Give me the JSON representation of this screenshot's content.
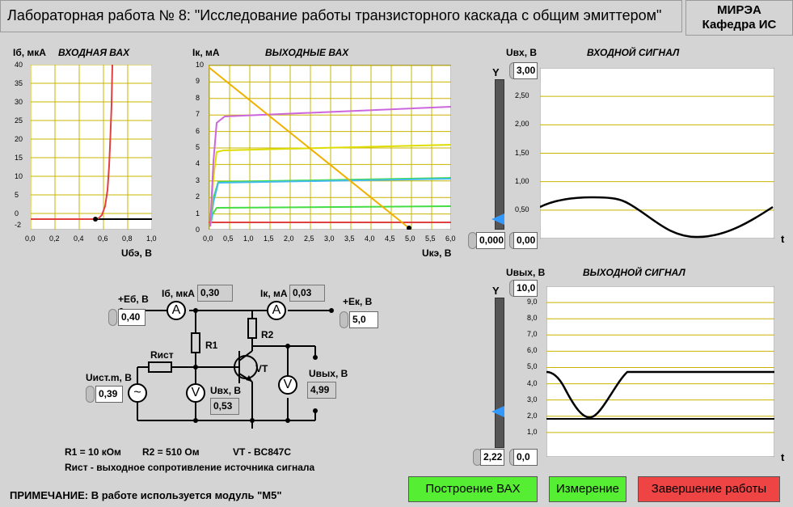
{
  "window": {
    "title": "Лабораторная работа № 8: \"Исследование работы транзисторного каскада с общим эмиттером\"",
    "org_line1": "МИРЭА",
    "org_line2": "Кафедра ИС"
  },
  "input_vax": {
    "ylabel": "Iб, мкА",
    "title": "ВХОДНАЯ ВАХ",
    "xlabel": "Uбэ, В",
    "yticks": [
      "40",
      "35",
      "30",
      "25",
      "20",
      "15",
      "10",
      "5",
      "0",
      "-2"
    ],
    "xticks": [
      "0,0",
      "0,2",
      "0,4",
      "0,6",
      "0,8",
      "1,0"
    ]
  },
  "output_vax": {
    "ylabel": "Iк, мА",
    "title": "ВЫХОДНЫЕ ВАХ",
    "xlabel": "Uкэ, В",
    "yticks": [
      "10",
      "9",
      "8",
      "7",
      "6",
      "5",
      "4",
      "3",
      "2",
      "1",
      "0"
    ],
    "xticks": [
      "0,0",
      "0,5",
      "1,0",
      "1,5",
      "2,0",
      "2,5",
      "3,0",
      "3,5",
      "4,0",
      "4,5",
      "5,0",
      "5,5",
      "6,0"
    ]
  },
  "input_signal": {
    "ylabel": "Uвх, В",
    "title": "ВХОДНОЙ СИГНАЛ",
    "yticks": [
      "2,50",
      "2,00",
      "1,50",
      "1,00",
      "0,50"
    ],
    "scale_max": "3,00",
    "scale_min": "0,00",
    "slider_label": "Y",
    "slider_value": "0,000",
    "t_label": "t"
  },
  "output_signal": {
    "ylabel": "Uвых, В",
    "title": "ВЫХОДНОЙ СИГНАЛ",
    "yticks": [
      "9,0",
      "8,0",
      "7,0",
      "6,0",
      "5,0",
      "4,0",
      "3,0",
      "2,0",
      "1,0"
    ],
    "scale_max": "10,0",
    "scale_min": "0,0",
    "slider_label": "Y",
    "slider_value": "2,22",
    "t_label": "t"
  },
  "circuit": {
    "eb_label": "+Eб, В",
    "eb_value": "0,40",
    "ib_label": "Iб, мкА",
    "ib_value": "0,30",
    "ik_label": "Iк, мА",
    "ik_value": "0,03",
    "ek_label": "+Eк, В",
    "ek_value": "5,0",
    "r1": "R1",
    "r2": "R2",
    "rist": "Rист",
    "vt": "VT",
    "uist_label": "Uист.m, В",
    "uist_value": "0,39",
    "uvx_label": "Uвх, В",
    "uvx_value": "0,53",
    "uvyx_label": "Uвых, В",
    "uvyx_value": "4,99",
    "ammeter": "A",
    "voltmeter": "V",
    "source": "~",
    "r1_value": "R1 = 10 кОм",
    "r2_value": "R2 =  510 Ом",
    "vt_value": "VT - BC847C",
    "rist_note": "Rист - выходное сопротивление источника сигнала"
  },
  "note": "ПРИМЕЧАНИЕ: В работе используется модуль \"М5\"",
  "buttons": {
    "build_vax": "Построение ВАХ",
    "measure": "Измерение",
    "finish": "Завершение работы"
  },
  "colors": {
    "green_button": "#55ee33",
    "red_button": "#ee4444",
    "grid": "#c8b400",
    "curve_input": "#e04040",
    "load_line": "#f0b000",
    "slider_pointer": "#3399ff"
  }
}
